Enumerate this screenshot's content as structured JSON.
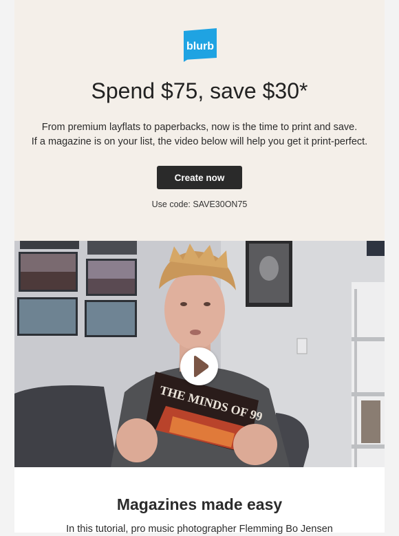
{
  "brand": {
    "logo_text": "blurb",
    "accent": "#1fa3e2"
  },
  "hero": {
    "headline": "Spend $75, save $30*",
    "line1": "From premium layflats to paperbacks, now is the time to print and save.",
    "line2": "If a magazine is on your list, the video below will help you get it print-perfect.",
    "cta_label": "Create now",
    "code_text": "Use code: SAVE30ON75",
    "background": "#f4efe9"
  },
  "video": {
    "magazine_title": "THE MINDS OF 99",
    "play_icon": "play-icon"
  },
  "section": {
    "title": "Magazines made easy",
    "intro": "In this tutorial, pro music photographer Flemming Bo Jensen"
  }
}
